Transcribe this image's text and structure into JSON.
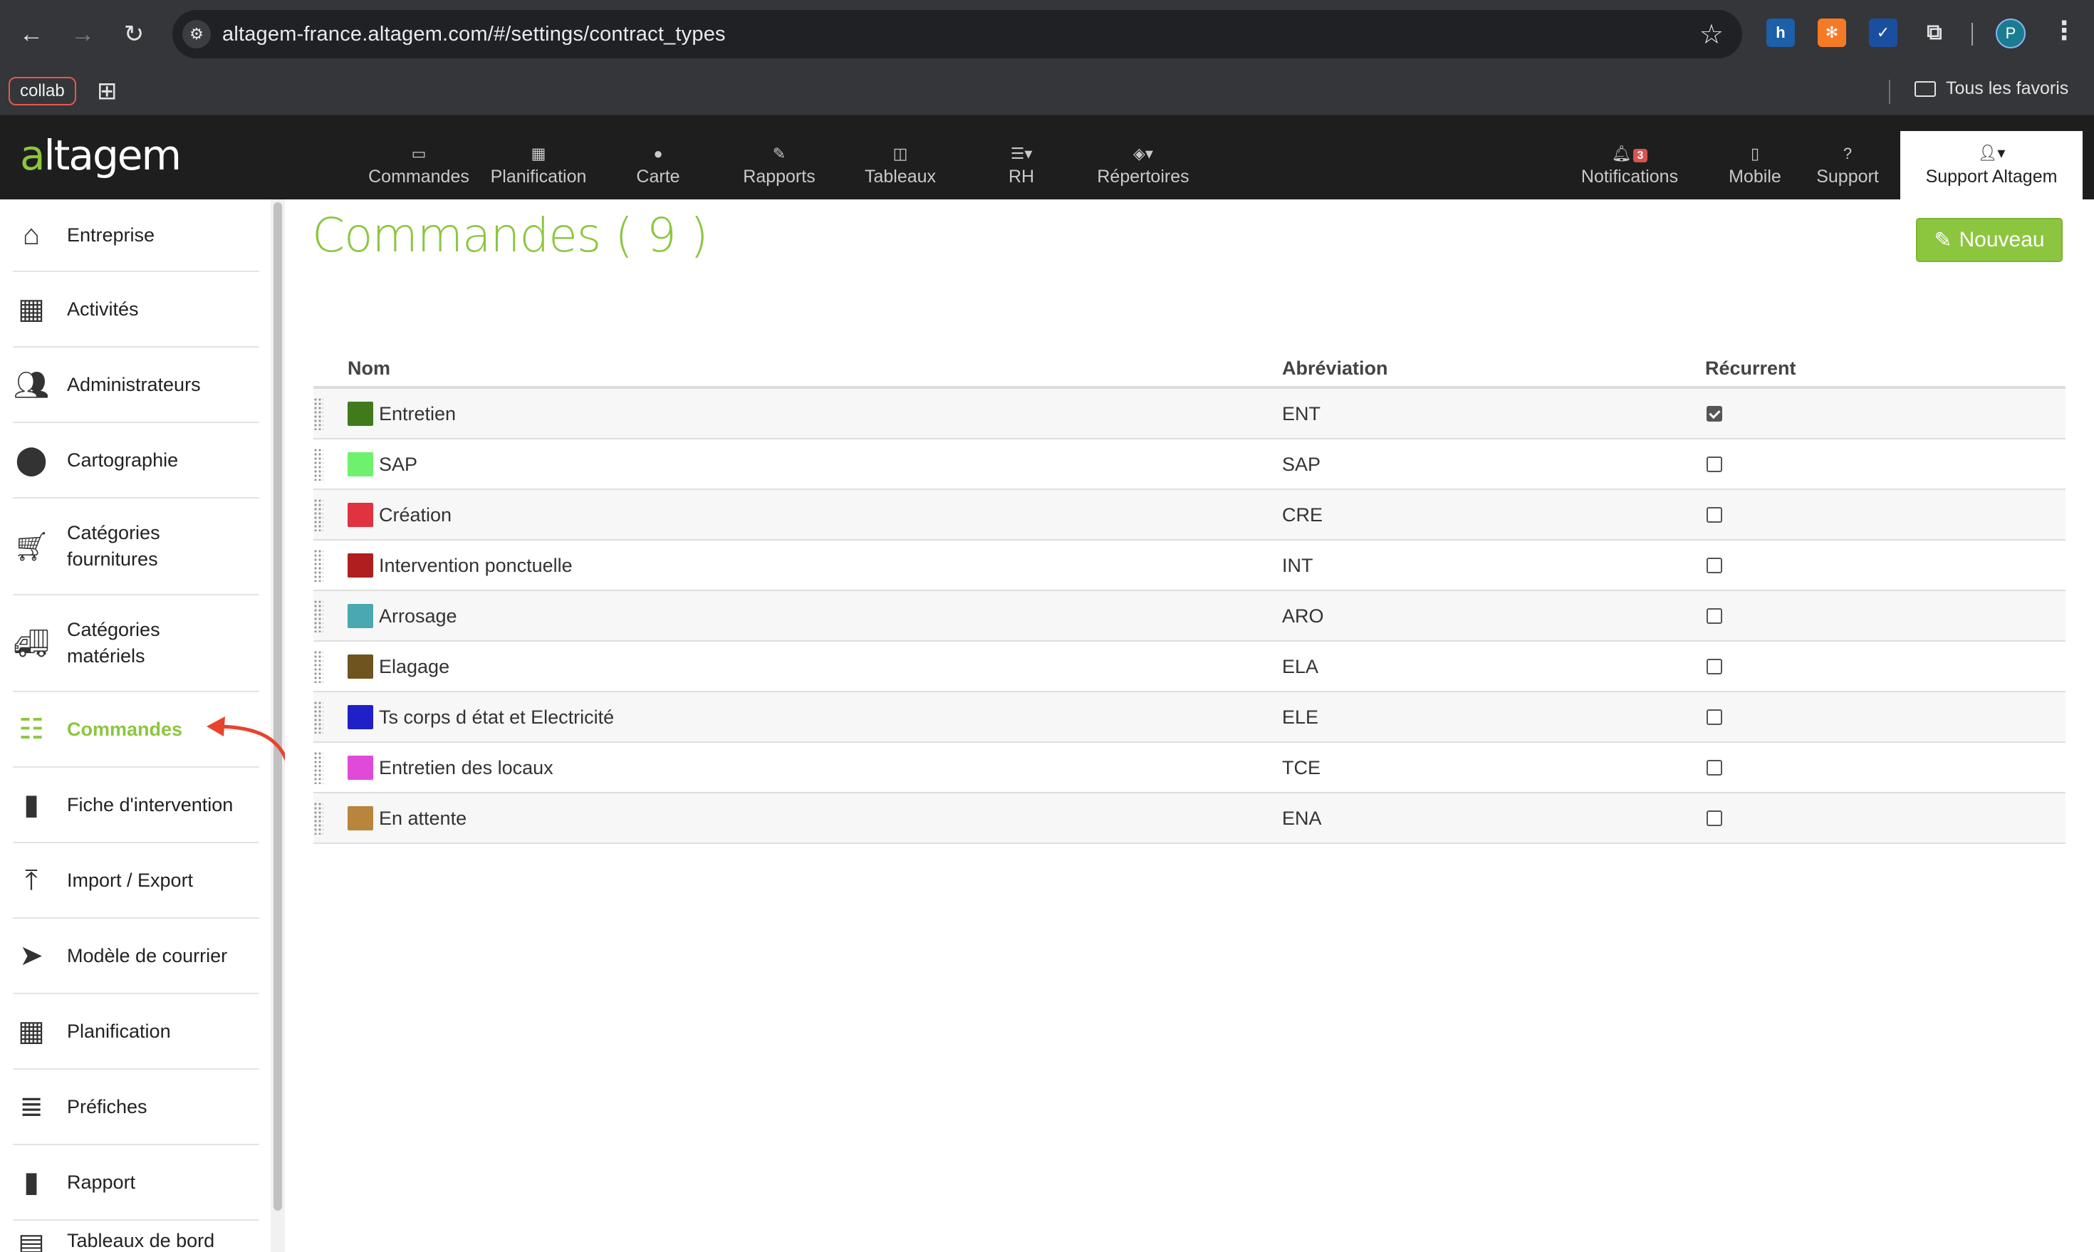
{
  "browser": {
    "url": "altagem-france.altagem.com/#/settings/contract_types",
    "bookmark_chip": "collab",
    "all_bookmarks": "Tous les favoris",
    "profile_initial": "P"
  },
  "app": {
    "logo": "altagem",
    "nav": [
      {
        "icon": "inbox-icon",
        "label": "Commandes"
      },
      {
        "icon": "calendar-icon",
        "label": "Planification"
      },
      {
        "icon": "map-pin-icon",
        "label": "Carte"
      },
      {
        "icon": "edit-icon",
        "label": "Rapports"
      },
      {
        "icon": "columns-icon",
        "label": "Tableaux"
      },
      {
        "icon": "list-icon",
        "label": "RH"
      },
      {
        "icon": "cube-icon",
        "label": "Répertoires"
      }
    ],
    "notifications": {
      "label": "Notifications",
      "count": "3"
    },
    "mobile": "Mobile",
    "support": "Support",
    "user_menu": "Support Altagem"
  },
  "sidebar": {
    "items": [
      {
        "icon": "home-icon",
        "label": "Entreprise"
      },
      {
        "icon": "grid-icon",
        "label": "Activités"
      },
      {
        "icon": "users-icon",
        "label": "Administrateurs"
      },
      {
        "icon": "map-marker-icon",
        "label": "Cartographie"
      },
      {
        "icon": "cart-icon",
        "label": "Catégories fournitures"
      },
      {
        "icon": "truck-icon",
        "label": "Catégories matériels"
      },
      {
        "icon": "list-icon",
        "label": "Commandes",
        "active": true
      },
      {
        "icon": "file-icon",
        "label": "Fiche d'intervention"
      },
      {
        "icon": "upload-icon",
        "label": "Import / Export"
      },
      {
        "icon": "paper-plane-icon",
        "label": "Modèle de courrier"
      },
      {
        "icon": "calendar-icon",
        "label": "Planification"
      },
      {
        "icon": "server-icon",
        "label": "Préfiches"
      },
      {
        "icon": "file-icon",
        "label": "Rapport"
      },
      {
        "icon": "table-icon",
        "label": "Tableaux de bord"
      }
    ]
  },
  "main": {
    "title": "Commandes ( 9 )",
    "new_button": "Nouveau",
    "columns": {
      "name": "Nom",
      "abbr": "Abréviation",
      "recurrent": "Récurrent"
    },
    "rows": [
      {
        "name": "Entretien",
        "abbr": "ENT",
        "color": "#3f7a1d",
        "recurrent": true
      },
      {
        "name": "SAP",
        "abbr": "SAP",
        "color": "#6ef26e",
        "recurrent": false
      },
      {
        "name": "Création",
        "abbr": "CRE",
        "color": "#e0323f",
        "recurrent": false
      },
      {
        "name": "Intervention ponctuelle",
        "abbr": "INT",
        "color": "#b01e1e",
        "recurrent": false
      },
      {
        "name": "Arrosage",
        "abbr": "ARO",
        "color": "#4aa8b3",
        "recurrent": false
      },
      {
        "name": "Elagage",
        "abbr": "ELA",
        "color": "#6f5420",
        "recurrent": false
      },
      {
        "name": "Ts corps d état et Electricité",
        "abbr": "ELE",
        "color": "#2020c8",
        "recurrent": false
      },
      {
        "name": "Entretien des locaux",
        "abbr": "TCE",
        "color": "#e04ad8",
        "recurrent": false
      },
      {
        "name": "En attente",
        "abbr": "ENA",
        "color": "#b9843c",
        "recurrent": false
      }
    ]
  }
}
